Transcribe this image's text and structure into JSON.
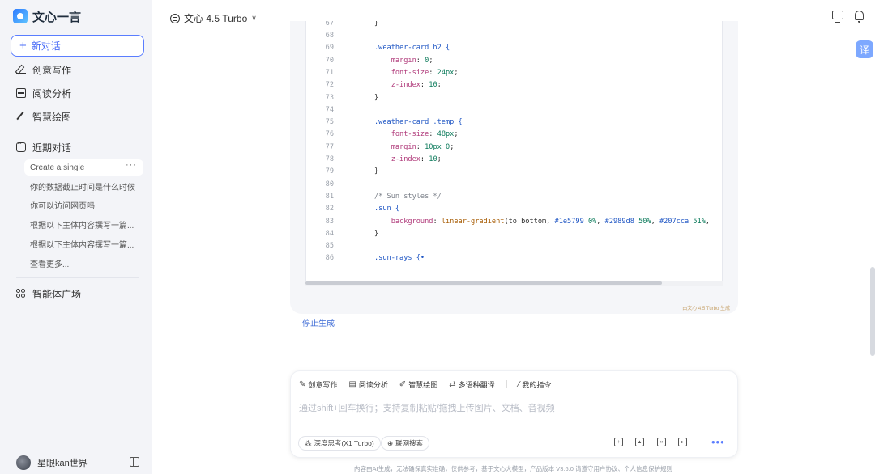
{
  "app": {
    "logo_text": "文心一言"
  },
  "sidebar": {
    "new_chat_label": "新对话",
    "nav": [
      {
        "label": "创意写作",
        "icon": "pen-icon"
      },
      {
        "label": "阅读分析",
        "icon": "document-icon"
      },
      {
        "label": "智慧绘图",
        "icon": "brush-icon"
      }
    ],
    "recent_label": "近期对话",
    "history": [
      "Create a single",
      "你的数据截止时间是什么时候",
      "你可以访问网页吗",
      "根据以下主体内容撰写一篇...",
      "根据以下主体内容撰写一篇...",
      "查看更多..."
    ],
    "history_more": "···",
    "agents_label": "智能体广场",
    "user_name": "星眼kan世界"
  },
  "header": {
    "model_label": "文心 4.5 Turbo",
    "translate_label": "译"
  },
  "code": {
    "lines": [
      {
        "n": "67",
        "t": "}"
      },
      {
        "n": "68",
        "t": ""
      },
      {
        "n": "69",
        "t": ".weather-card h2 {"
      },
      {
        "n": "70",
        "t": "    margin: 0;"
      },
      {
        "n": "71",
        "t": "    font-size: 24px;"
      },
      {
        "n": "72",
        "t": "    z-index: 10;"
      },
      {
        "n": "73",
        "t": "}"
      },
      {
        "n": "74",
        "t": ""
      },
      {
        "n": "75",
        "t": ".weather-card .temp {"
      },
      {
        "n": "76",
        "t": "    font-size: 48px;"
      },
      {
        "n": "77",
        "t": "    margin: 10px 0;"
      },
      {
        "n": "78",
        "t": "    z-index: 10;"
      },
      {
        "n": "79",
        "t": "}"
      },
      {
        "n": "80",
        "t": ""
      },
      {
        "n": "81",
        "t": "/* Sun styles */"
      },
      {
        "n": "82",
        "t": ".sun {"
      },
      {
        "n": "83",
        "t": "    background: linear-gradient(to bottom, #1e5799 0%, #2989d8 50%, #207cca 51%,"
      },
      {
        "n": "84",
        "t": "}"
      },
      {
        "n": "85",
        "t": ""
      },
      {
        "n": "86",
        "t": ".sun-rays {•"
      }
    ],
    "watermark": "由文心 4.5 Turbo 生成"
  },
  "stop_label": "停止生成",
  "input": {
    "tools": [
      {
        "label": "创意写作",
        "icon": "pen-icon"
      },
      {
        "label": "阅读分析",
        "icon": "document-icon"
      },
      {
        "label": "智慧绘图",
        "icon": "brush-icon"
      },
      {
        "label": "多语种翻译",
        "icon": "translate-icon"
      },
      {
        "label": "我的指令",
        "icon": "slash-icon"
      }
    ],
    "placeholder": "通过shift+回车换行；支持复制粘贴/拖拽上传图片、文档、音视频",
    "deep_think_label": "深度思考(X1 Turbo)",
    "web_search_label": "联网搜索",
    "more": "•••"
  },
  "footer_note": "内容由AI生成，无法确保真实准确，仅供参考，基于文心大模型，产品版本 V3.6.0 请遵守用户协议、个人信息保护规则"
}
